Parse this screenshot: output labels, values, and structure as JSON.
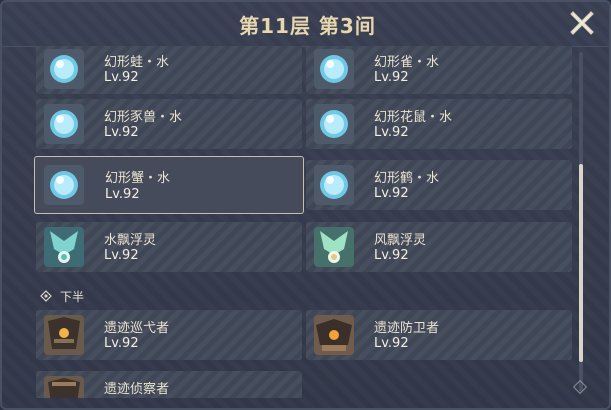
{
  "header": {
    "title": "第11层 第3间"
  },
  "cards": [
    {
      "name": "幻形蛙・水",
      "level": "Lv.92",
      "icon": "hydro-orb-icon"
    },
    {
      "name": "幻形雀・水",
      "level": "Lv.92",
      "icon": "hydro-orb-icon"
    },
    {
      "name": "幻形豕兽・水",
      "level": "Lv.92",
      "icon": "hydro-orb-icon"
    },
    {
      "name": "幻形花鼠・水",
      "level": "Lv.92",
      "icon": "hydro-orb-icon"
    },
    {
      "name": "幻形蟹・水",
      "level": "Lv.92",
      "icon": "hydro-orb-icon",
      "selected": true
    },
    {
      "name": "幻形鹤・水",
      "level": "Lv.92",
      "icon": "hydro-orb-icon"
    },
    {
      "name": "水飘浮灵",
      "level": "Lv.92",
      "icon": "hydro-specter-icon"
    },
    {
      "name": "风飘浮灵",
      "level": "Lv.92",
      "icon": "anemo-specter-icon"
    },
    {
      "name": "遗迹巡弋者",
      "level": "Lv.92",
      "icon": "ruin-machine-icon"
    },
    {
      "name": "遗迹防卫者",
      "level": "Lv.92",
      "icon": "ruin-machine-icon"
    },
    {
      "name": "遗迹侦察者",
      "level": "",
      "icon": "ruin-machine-icon"
    }
  ],
  "section": {
    "label": "下半"
  },
  "colors": {
    "title": "#e8d7ae",
    "card_bg": "#414858",
    "panel_bg": "#323849"
  }
}
